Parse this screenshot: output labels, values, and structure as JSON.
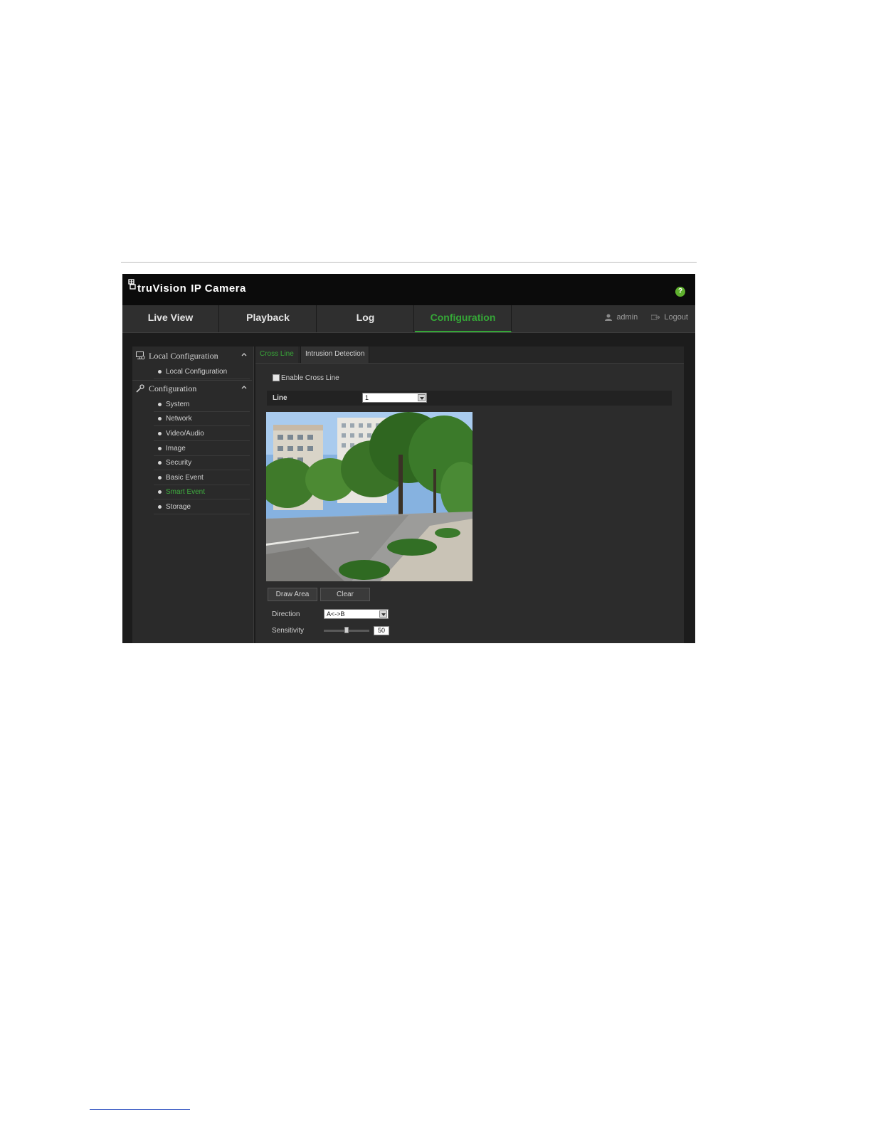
{
  "app": {
    "brand_name": "truVision",
    "brand_product": "IP Camera"
  },
  "nav": {
    "tabs": [
      "Live View",
      "Playback",
      "Log",
      "Configuration"
    ],
    "active": "Configuration",
    "user": "admin",
    "logout": "Logout"
  },
  "sidebar": {
    "local_header": "Local Configuration",
    "local_items": [
      "Local Configuration"
    ],
    "config_header": "Configuration",
    "config_items": [
      "System",
      "Network",
      "Video/Audio",
      "Image",
      "Security",
      "Basic Event",
      "Smart Event",
      "Storage"
    ],
    "active_item": "Smart Event"
  },
  "content": {
    "tabs": [
      "Cross Line",
      "Intrusion Detection"
    ],
    "active_tab": "Cross Line",
    "enable_label": "Enable Cross Line",
    "line_label": "Line",
    "line_value": "1",
    "draw_button": "Draw Area",
    "clear_button": "Clear",
    "direction_label": "Direction",
    "direction_value": "A<->B",
    "sensitivity_label": "Sensitivity",
    "sensitivity_value": "50"
  },
  "colors": {
    "accent_green": "#35a737",
    "topbar": "#0b0b0b",
    "navbar": "#2f2f2f",
    "panel": "#2c2c2c"
  },
  "icons": [
    "camera-logo-icon",
    "help-icon",
    "user-icon",
    "logout-icon",
    "monitor-gear-icon",
    "wrench-icon",
    "chevron-up-icon",
    "dropdown-arrow-icon"
  ]
}
